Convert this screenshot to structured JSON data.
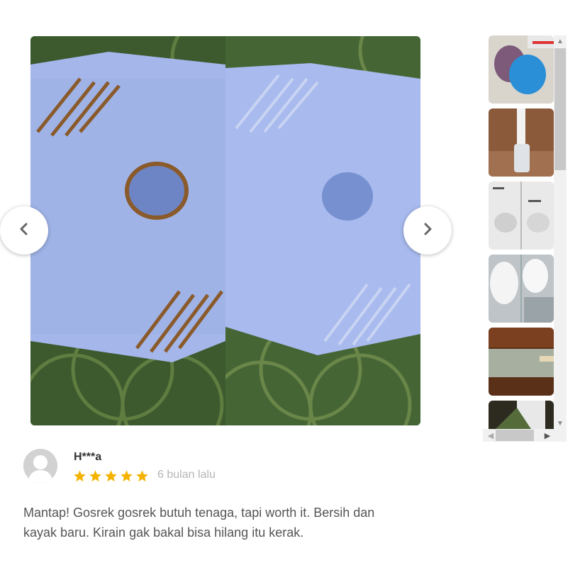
{
  "viewer": {
    "prev_label": "previous image",
    "next_label": "next image"
  },
  "thumbnails": [
    {
      "name": "cleaning-cloths"
    },
    {
      "name": "toilet-brush"
    },
    {
      "name": "toilet-before-after"
    },
    {
      "name": "toilet-bowl-closeup"
    },
    {
      "name": "scrub-pad"
    },
    {
      "name": "partial-thumbnail"
    }
  ],
  "review": {
    "reviewer": "H***a",
    "rating": 5,
    "date": "6 bulan lalu",
    "text": "Mantap! Gosrek gosrek butuh tenaga, tapi worth it. Bersih dan kayak baru. Kirain gak bakal bisa hilang itu kerak."
  },
  "colors": {
    "star": "#f5b301",
    "toilet": "#9fb2e6",
    "tile": "#3f5a2f",
    "stain": "#8a5a2a"
  }
}
